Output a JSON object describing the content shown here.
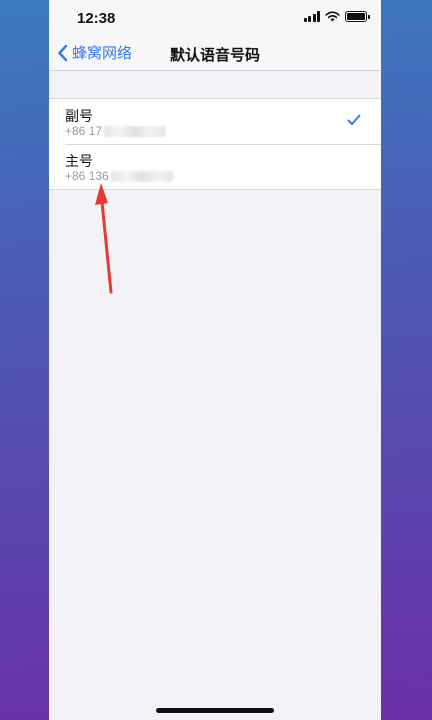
{
  "status_bar": {
    "time": "12:38"
  },
  "nav": {
    "back_label": "蜂窝网络",
    "title": "默认语音号码"
  },
  "lines": [
    {
      "title": "副号",
      "number_prefix": "+86 17",
      "selected": true
    },
    {
      "title": "主号",
      "number_prefix": "+86 136",
      "selected": false
    }
  ],
  "colors": {
    "accent": "#3478f6",
    "annotation_arrow": "#e53935"
  }
}
